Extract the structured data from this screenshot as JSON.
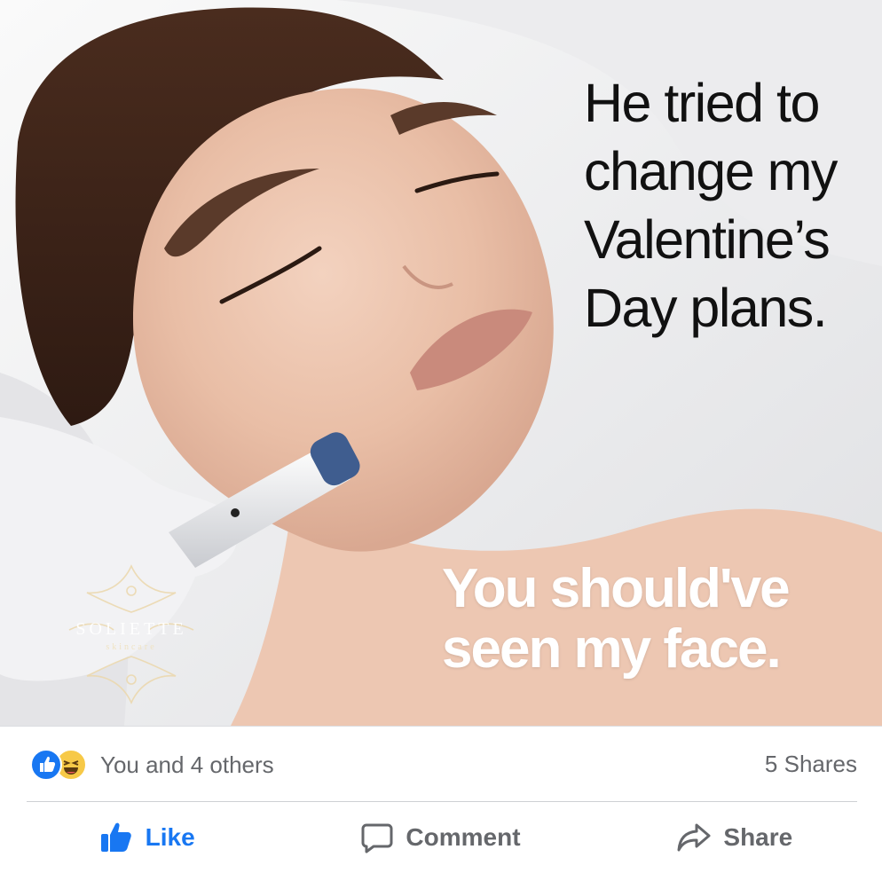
{
  "post": {
    "headline": "He tried to\nchange my\nValentine’s\nDay plans.",
    "punchline": "You should've\nseen my face.",
    "logo": {
      "brand": "SOLIETTE",
      "sub": "skincare"
    }
  },
  "engagement": {
    "reaction_icons": [
      "like-icon",
      "haha-icon"
    ],
    "reactions_text": "You and 4 others",
    "shares_text": "5 Shares"
  },
  "actions": {
    "like_label": "Like",
    "comment_label": "Comment",
    "share_label": "Share"
  },
  "colors": {
    "like_blue": "#1877f2",
    "secondary_text": "#65676b",
    "haha_yellow": "#f7c947"
  }
}
